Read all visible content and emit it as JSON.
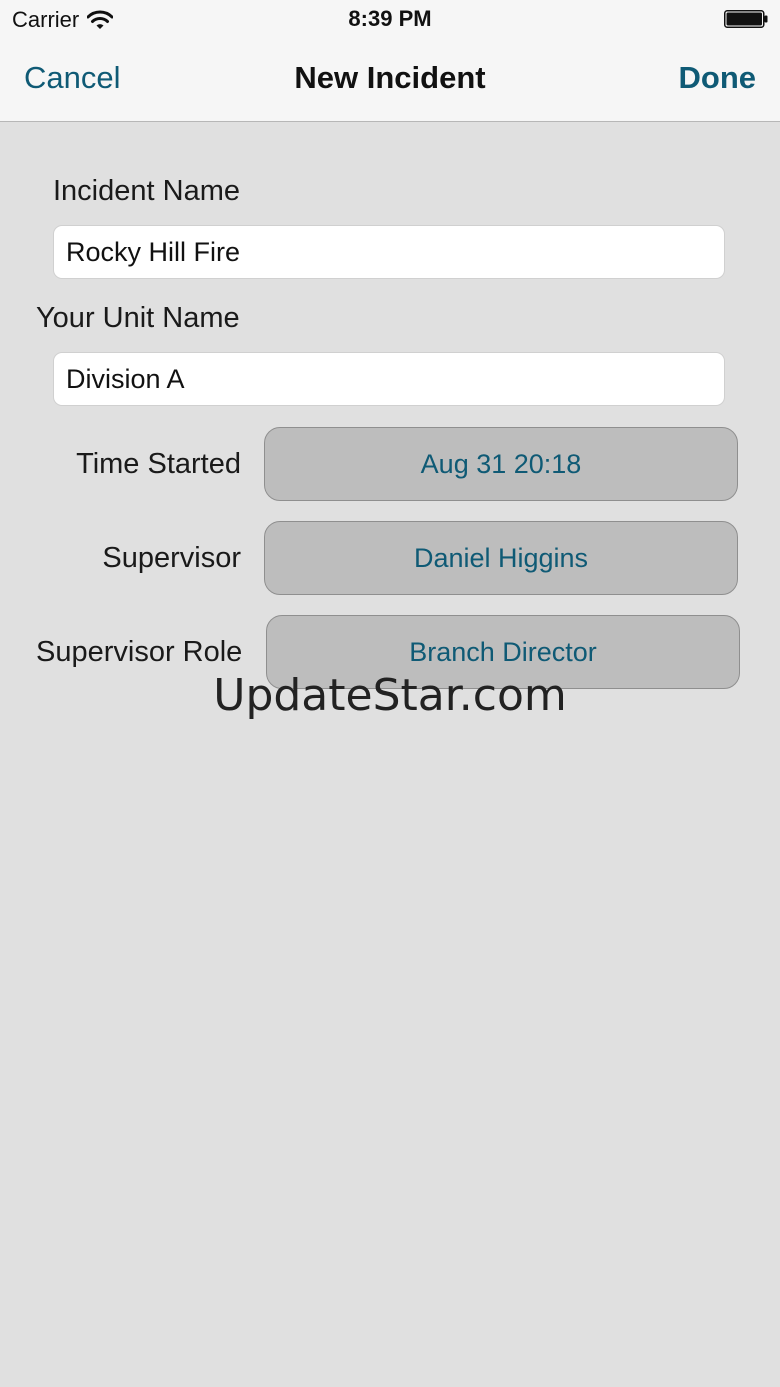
{
  "status_bar": {
    "carrier": "Carrier",
    "time": "8:39 PM",
    "icons": [
      "wifi-icon",
      "battery-icon"
    ]
  },
  "nav": {
    "cancel_label": "Cancel",
    "title": "New Incident",
    "done_label": "Done"
  },
  "form": {
    "incident_name": {
      "label": "Incident Name",
      "value": "Rocky Hill Fire"
    },
    "unit_name": {
      "label": "Your Unit Name",
      "value": "Division A"
    },
    "time_started": {
      "label": "Time Started",
      "value": "Aug 31 20:18"
    },
    "supervisor": {
      "label": "Supervisor",
      "value": "Daniel Higgins"
    },
    "supervisor_role": {
      "label": "Supervisor Role",
      "value": "Branch Director"
    }
  },
  "watermark": "UpdateStar.com",
  "colors": {
    "accent": "#0f5a75",
    "background": "#e0e0e0",
    "nav_background": "#f6f6f6",
    "button_fill": "#bdbdbd"
  }
}
